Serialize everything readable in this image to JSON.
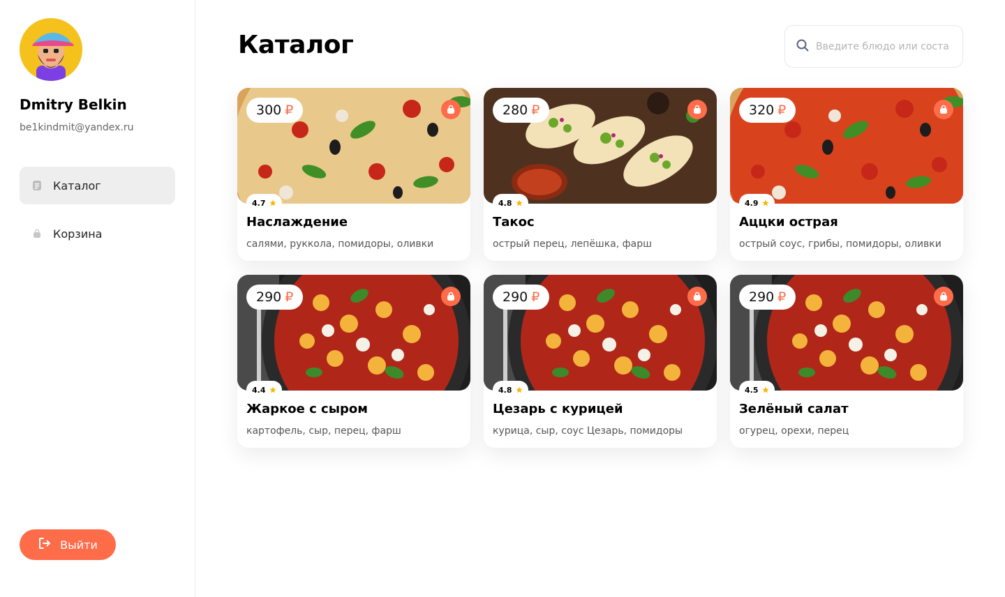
{
  "user": {
    "name": "Dmitry Belkin",
    "email": "be1kindmit@yandex.ru"
  },
  "menu": {
    "items": [
      {
        "label": "Каталог",
        "icon": "list-icon",
        "active": true
      },
      {
        "label": "Корзина",
        "icon": "bag-icon",
        "active": false
      }
    ],
    "logout_label": "Выйти"
  },
  "page": {
    "title": "Каталог",
    "search_placeholder": "Введите блюдо или состав"
  },
  "currency_symbol": "₽",
  "colors": {
    "accent": "#fe6c4a",
    "star": "#f5b700"
  },
  "products": [
    {
      "price": "300",
      "rating": "4.7",
      "name": "Наслаждение",
      "ingredients": "салями, руккола, помидоры, оливки",
      "image": "pizza"
    },
    {
      "price": "280",
      "rating": "4.8",
      "name": "Такос",
      "ingredients": "острый перец, лепёшка, фарш",
      "image": "tacos"
    },
    {
      "price": "320",
      "rating": "4.9",
      "name": "Аццки острая",
      "ingredients": "острый соус, грибы, помидоры, оливки",
      "image": "pizza-red"
    },
    {
      "price": "290",
      "rating": "4.4",
      "name": "Жаркое с сыром",
      "ingredients": "картофель, сыр, перец, фарш",
      "image": "gnocchi"
    },
    {
      "price": "290",
      "rating": "4.8",
      "name": "Цезарь с курицей",
      "ingredients": "курица, сыр, соус Цезарь, помидоры",
      "image": "gnocchi"
    },
    {
      "price": "290",
      "rating": "4.5",
      "name": "Зелёный салат",
      "ingredients": "огурец, орехи, перец",
      "image": "gnocchi"
    }
  ]
}
